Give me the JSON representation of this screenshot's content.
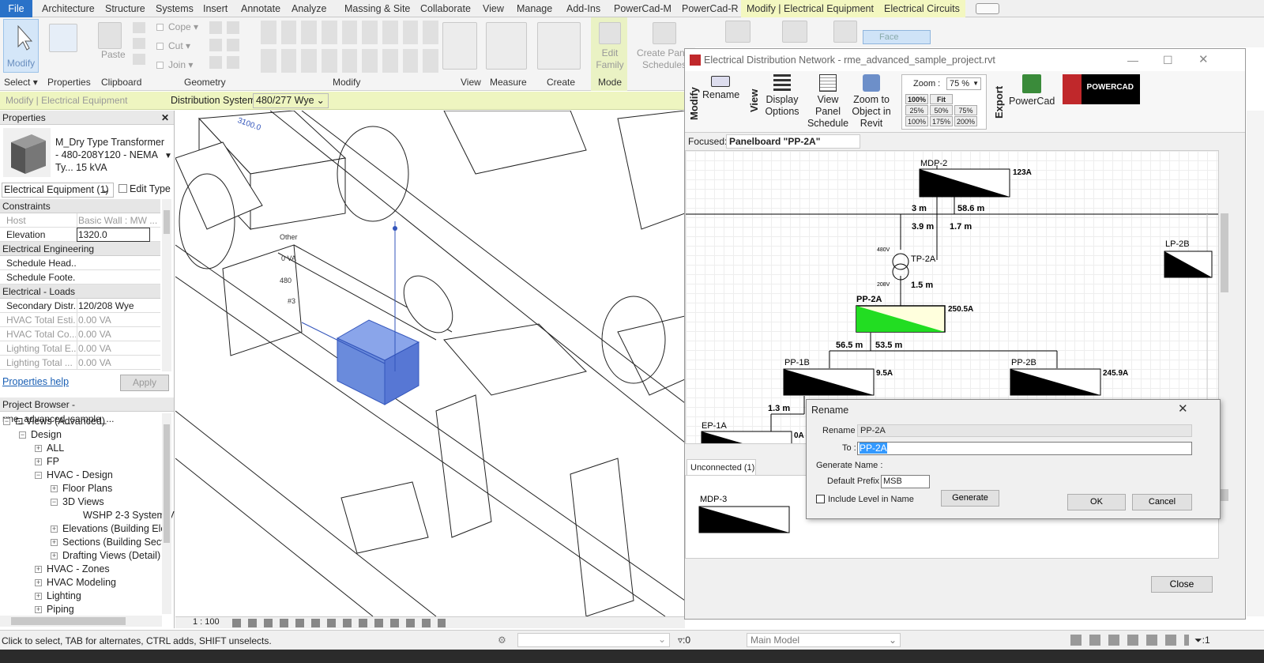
{
  "ribbon_tabs": [
    "File",
    "Architecture",
    "Structure",
    "Systems",
    "Insert",
    "Annotate",
    "Analyze",
    "Massing & Site",
    "Collaborate",
    "View",
    "Manage",
    "Add-Ins",
    "PowerCad-M",
    "PowerCad-R",
    "Modify | Electrical Equipment",
    "Electrical Circuits"
  ],
  "ribbon": {
    "modify_label": "Modify",
    "paste_label": "Paste",
    "cope_label": "Cope",
    "cut_label": "Cut",
    "join_label": "Join",
    "edit_family_label": "Edit Family",
    "create_panel_label": "Create Panel Schedules",
    "face_label": "Face",
    "groups": [
      "Select",
      "Properties",
      "Clipboard",
      "Geometry",
      "Modify",
      "View",
      "Measure",
      "Create",
      "Mode"
    ]
  },
  "context_bar": {
    "label": "Modify | Electrical Equipment",
    "dist_label": "Distribution System:",
    "dist_value": "480/277 Wye"
  },
  "properties": {
    "title": "Properties",
    "type_name": "M_Dry Type Transformer - 480-208Y120 - NEMA Ty... 15 kVA",
    "selector": "Electrical Equipment (1)",
    "edit_type": "Edit Type",
    "groups": [
      "Constraints",
      "Electrical Engineering",
      "Electrical - Loads"
    ],
    "rows": [
      {
        "k": "Host",
        "v": "Basic Wall : MW ..."
      },
      {
        "k": "Elevation",
        "v": "1320.0"
      },
      {
        "k": "Schedule Head...",
        "v": ""
      },
      {
        "k": "Schedule Foote...",
        "v": ""
      },
      {
        "k": "Secondary Distr...",
        "v": "120/208 Wye"
      },
      {
        "k": "HVAC Total Esti...",
        "v": "0.00 VA"
      },
      {
        "k": "HVAC Total Co...",
        "v": "0.00 VA"
      },
      {
        "k": "Lighting Total E...",
        "v": "0.00 VA"
      },
      {
        "k": "Lighting Total ...",
        "v": "0.00 VA"
      }
    ],
    "help": "Properties help",
    "apply": "Apply"
  },
  "browser": {
    "title": "Project Browser - rme_advanced_sample_...",
    "nodes": [
      "Views (Advanced)",
      "Design",
      "ALL",
      "FP",
      "HVAC - Design",
      "Floor Plans",
      "3D Views",
      "WSHP 2-3 System V",
      "Elevations (Building Ele",
      "Sections (Building Sect",
      "Drafting Views (Detail)",
      "HVAC - Zones",
      "HVAC Modeling",
      "Lighting",
      "Piping"
    ]
  },
  "viewport": {
    "labels": [
      "3100.0",
      "Other",
      "0 VA",
      "480",
      "#3"
    ],
    "scale": "1 : 100"
  },
  "status": {
    "hint": "Click to select, TAB for alternates, CTRL adds, SHIFT unselects.",
    "count": ":0",
    "model": "Main Model",
    "filter": ":1"
  },
  "edn": {
    "title": "Electrical Distribution Network - rme_advanced_sample_project.rvt",
    "tools": {
      "modify": "Modify",
      "rename": "Rename",
      "view": "View",
      "display": "Display Options",
      "view_panel": "View Panel Schedule",
      "zoom_to": "Zoom to Object in Revit",
      "export": "Export",
      "powercad": "PowerCad",
      "logo": "POWERCAD"
    },
    "zoom": {
      "label": "Zoom :",
      "value": "75 %",
      "fit": "Fit",
      "presets": [
        "100%",
        "25%",
        "50%",
        "75%",
        "100%",
        "175%",
        "200%"
      ]
    },
    "focused_label": "Focused:",
    "focused_value": "Panelboard \"PP-2A\"",
    "nodes": {
      "mdp2": "MDP-2",
      "mdp2_amp": "123A",
      "tp2a": "TP-2A",
      "pp2a": "PP-2A",
      "pp2a_amp": "250.5A",
      "lp2b": "LP-2B",
      "pp1b": "PP-1B",
      "pp1b_amp": "9.5A",
      "pp2b": "PP-2B",
      "pp2b_amp": "245.9A",
      "ep1a": "EP-1A",
      "ep1a_amp": "0A",
      "v480": "480V",
      "v208": "208V"
    },
    "dist": {
      "d1": "3 m",
      "d2": "58.6 m",
      "d3": "3.9 m",
      "d4": "1.7 m",
      "d5": "1.5 m",
      "d6": "56.5 m",
      "d7": "53.5 m",
      "d8": "1.3 m"
    },
    "unconnected_tab": "Unconnected (1)",
    "unconnected_node": "MDP-3",
    "close": "Close"
  },
  "rename_dialog": {
    "title": "Rename",
    "rename_label": "Rename :",
    "rename_value": "PP-2A",
    "to_label": "To :",
    "to_value": "PP-2A",
    "generate_name": "Generate Name :",
    "prefix_label": "Default Prefix",
    "prefix_value": "MSB",
    "include_level": "Include Level in Name",
    "generate": "Generate",
    "ok": "OK",
    "cancel": "Cancel"
  }
}
